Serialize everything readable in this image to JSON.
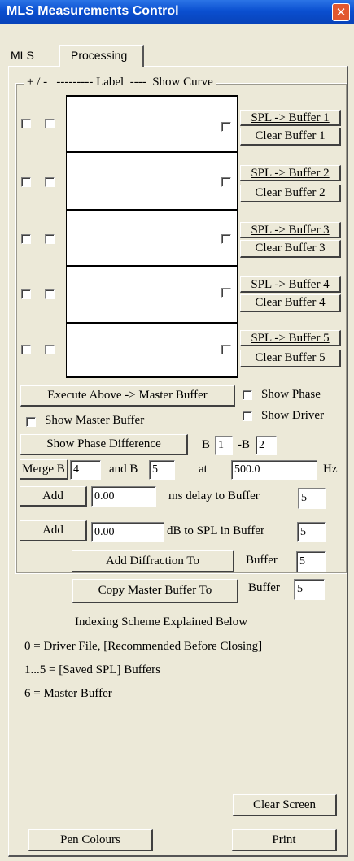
{
  "window": {
    "title": "MLS Measurements Control",
    "close_glyph": "✕"
  },
  "tabs": [
    {
      "label": "MLS"
    },
    {
      "label": "Processing"
    }
  ],
  "group": {
    "legend": "+ / -   --------- Label  ----  Show Curve"
  },
  "buffer_rows": [
    {
      "spl_label": "SPL -> Buffer 1",
      "clear_label": "Clear Buffer 1"
    },
    {
      "spl_label": "SPL -> Buffer 2",
      "clear_label": "Clear Buffer 2"
    },
    {
      "spl_label": "SPL -> Buffer 3",
      "clear_label": "Clear Buffer 3"
    },
    {
      "spl_label": "SPL -> Buffer 4",
      "clear_label": "Clear Buffer 4"
    },
    {
      "spl_label": "SPL -> Buffer 5",
      "clear_label": "Clear Buffer 5"
    }
  ],
  "execute_label": "Execute Above -> Master Buffer",
  "show_phase_label": "Show Phase",
  "show_master_label": "Show Master Buffer",
  "show_driver_label": "Show Driver",
  "phase_diff": {
    "button": "Show Phase Difference",
    "b_label": "B",
    "b_value": "1",
    "minus_b_label": "-B",
    "minus_b_value": "2"
  },
  "merge": {
    "button": "Merge B",
    "b1": "4",
    "and_label": "and B",
    "b2": "5",
    "at_label": "at",
    "freq": "500.0",
    "unit": "Hz"
  },
  "delay": {
    "button": "Add",
    "value": "0.00",
    "label": "ms delay to Buffer",
    "buffer": "5"
  },
  "db": {
    "button": "Add",
    "value": "0.00",
    "label": "dB to SPL in Buffer",
    "buffer": "5"
  },
  "diffraction": {
    "button": "Add Diffraction To",
    "label": "Buffer",
    "buffer": "5"
  },
  "copy": {
    "button": "Copy Master Buffer To",
    "label": "Buffer",
    "buffer": "5"
  },
  "indexing": {
    "title": "Indexing Scheme Explained Below",
    "line0": "0 = Driver File, [Recommended Before Closing]",
    "line1": "1...5 = [Saved SPL] Buffers",
    "line6": "6 = Master Buffer"
  },
  "clear_screen_label": "Clear Screen",
  "pen_colours_label": "Pen Colours",
  "print_label": "Print"
}
